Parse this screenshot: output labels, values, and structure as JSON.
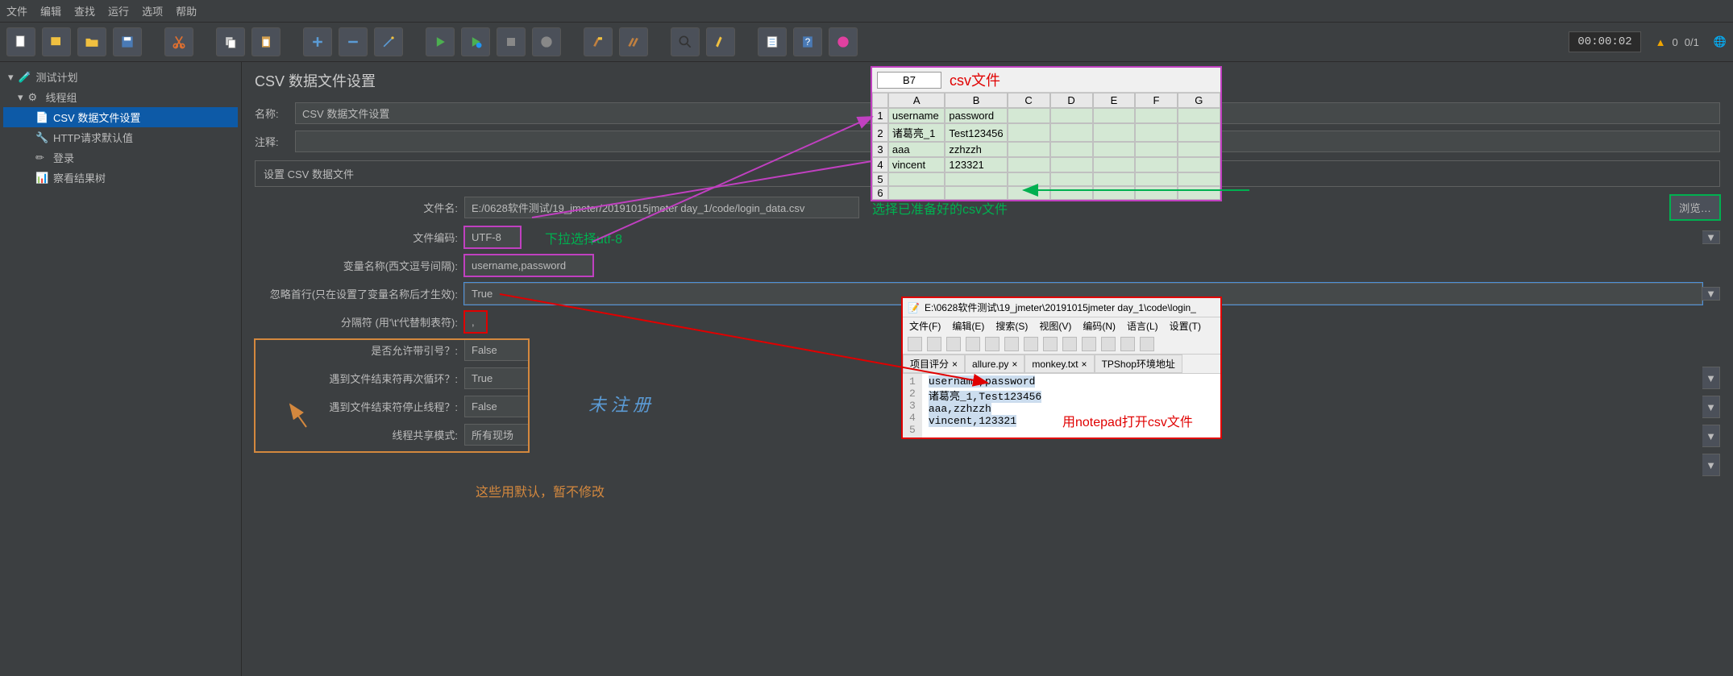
{
  "menu": {
    "file": "文件",
    "edit": "编辑",
    "search": "查找",
    "run": "运行",
    "options": "选项",
    "help": "帮助"
  },
  "toolbar": {
    "timer": "00:00:02",
    "warn_count": "0",
    "err_count": "0/1"
  },
  "tree": {
    "root": "测试计划",
    "thread_group": "线程组",
    "csv_config": "CSV 数据文件设置",
    "http_defaults": "HTTP请求默认值",
    "login": "登录",
    "result_tree": "察看结果树"
  },
  "panel": {
    "title": "CSV 数据文件设置",
    "name_label": "名称:",
    "name_value": "CSV 数据文件设置",
    "comment_label": "注释:",
    "comment_value": "",
    "section": "设置 CSV 数据文件",
    "filename_label": "文件名:",
    "filename_value": "E:/0628软件测试/19_jmeter/20191015jmeter day_1/code/login_data.csv",
    "browse": "浏览…",
    "encoding_label": "文件编码:",
    "encoding_value": "UTF-8",
    "varnames_label": "变量名称(西文逗号间隔):",
    "varnames_value": "username,password",
    "ignore_first_label": "忽略首行(只在设置了变量名称后才生效):",
    "ignore_first_value": "True",
    "delimiter_label": "分隔符 (用'\\t'代替制表符):",
    "delimiter_value": ",",
    "allow_quoted_label": "是否允许带引号？:",
    "allow_quoted_value": "False",
    "recycle_label": "遇到文件结束符再次循环？:",
    "recycle_value": "True",
    "stop_label": "遇到文件结束符停止线程？:",
    "stop_value": "False",
    "sharing_label": "线程共享模式:",
    "sharing_value": "所有现场"
  },
  "annot": {
    "csvfile": "csv文件",
    "select_csv": "选择已准备好的csv文件",
    "utf8_hint": "下拉选择utf-8",
    "defaults_hint": "这些用默认，暂不修改",
    "notepad_hint": "用notepad打开csv文件",
    "unregistered": "未 注 册"
  },
  "excel": {
    "cellref": "B7",
    "cols": [
      "A",
      "B",
      "C",
      "D",
      "E",
      "F",
      "G"
    ],
    "rows": [
      {
        "n": "1",
        "cells": [
          "username",
          "password",
          "",
          "",
          "",
          "",
          ""
        ]
      },
      {
        "n": "2",
        "cells": [
          "诸葛亮_1",
          "Test123456",
          "",
          "",
          "",
          "",
          ""
        ]
      },
      {
        "n": "3",
        "cells": [
          "aaa",
          "zzhzzh",
          "",
          "",
          "",
          "",
          ""
        ]
      },
      {
        "n": "4",
        "cells": [
          "vincent",
          "123321",
          "",
          "",
          "",
          "",
          ""
        ]
      },
      {
        "n": "5",
        "cells": [
          "",
          "",
          "",
          "",
          "",
          "",
          ""
        ]
      },
      {
        "n": "6",
        "cells": [
          "",
          "",
          "",
          "",
          "",
          "",
          ""
        ]
      }
    ]
  },
  "notepad": {
    "title": "E:\\0628软件测试\\19_jmeter\\20191015jmeter day_1\\code\\login_",
    "menu": {
      "file": "文件(F)",
      "edit": "编辑(E)",
      "search": "搜索(S)",
      "view": "视图(V)",
      "encoding": "编码(N)",
      "lang": "语言(L)",
      "settings": "设置(T)"
    },
    "tabs": [
      "项目评分",
      "allure.py",
      "monkey.txt",
      "TPShop环境地址"
    ],
    "lines": [
      "username,password",
      "诸葛亮_1,Test123456",
      "aaa,zzhzzh",
      "vincent,123321",
      ""
    ]
  }
}
